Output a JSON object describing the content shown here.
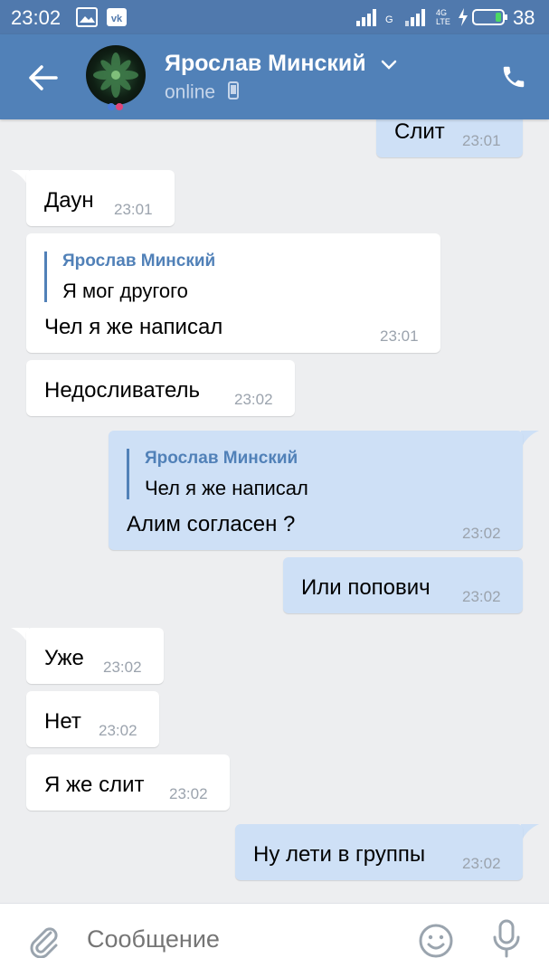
{
  "status_bar": {
    "time": "23:02",
    "network_label": "G",
    "network_label_2": "4G LTE",
    "battery": "38",
    "icons": [
      "image-icon",
      "vk-icon",
      "signal-icon",
      "signal-icon",
      "charging-icon",
      "battery-icon"
    ]
  },
  "header": {
    "name": "Ярослав Минский",
    "status": "online",
    "icons": [
      "back-arrow-icon",
      "chevron-down-icon",
      "mobile-device-icon",
      "phone-icon"
    ]
  },
  "messages": [
    {
      "dir": "out",
      "text": "Слит",
      "time": "23:01"
    },
    {
      "dir": "in",
      "text": "Даун",
      "time": "23:01"
    },
    {
      "dir": "in",
      "reply_author": "Ярослав Минский",
      "reply_text": "Я мог другого",
      "text": "Чел я же написал",
      "time": "23:01"
    },
    {
      "dir": "in",
      "text": "Недосливатель",
      "time": "23:02"
    },
    {
      "dir": "out",
      "reply_author": "Ярослав Минский",
      "reply_text": "Чел я же написал",
      "text": "Алим согласен ?",
      "time": "23:02"
    },
    {
      "dir": "out",
      "text": "Или попович",
      "time": "23:02"
    },
    {
      "dir": "in",
      "text": "Уже",
      "time": "23:02"
    },
    {
      "dir": "in",
      "text": "Нет",
      "time": "23:02"
    },
    {
      "dir": "in",
      "text": "Я же слит",
      "time": "23:02"
    },
    {
      "dir": "out",
      "text": "Ну лети в группы",
      "time": "23:02"
    }
  ],
  "composer": {
    "placeholder": "Сообщение",
    "icons": [
      "paperclip-icon",
      "smile-icon",
      "microphone-icon"
    ]
  },
  "colors": {
    "header_bg": "#5181b8",
    "status_bar_bg": "#5079ad",
    "chat_bg": "#edeef0",
    "incoming_bubble": "#ffffff",
    "outgoing_bubble": "#cee0f6",
    "reply_accent": "#5181b8",
    "time_text": "#9ba3ad"
  }
}
